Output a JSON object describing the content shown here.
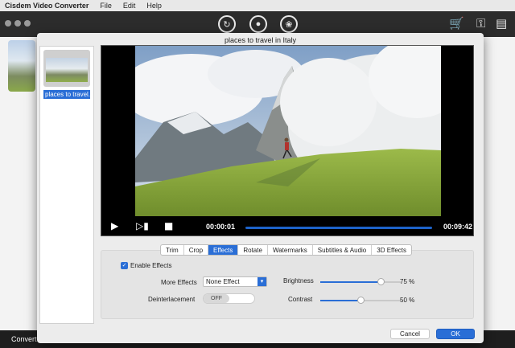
{
  "menubar": {
    "app_name": "Cisdem Video Converter",
    "items": [
      "File",
      "Edit",
      "Help"
    ]
  },
  "toolbar": {
    "icons": [
      "convert-icon",
      "dvd-icon",
      "film-reel-icon"
    ],
    "right_icons": [
      "cart-icon",
      "key-icon",
      "register-icon"
    ]
  },
  "bottom": {
    "convert_label": "Convert a"
  },
  "dialog": {
    "title": "places to travel in Italy",
    "list": {
      "item_label": "places to travel..."
    },
    "player": {
      "current_time": "00:00:01",
      "total_time": "00:09:42",
      "progress": 0.003
    },
    "tabs": [
      "Trim",
      "Crop",
      "Effects",
      "Rotate",
      "Watermarks",
      "Subtitles & Audio",
      "3D Effects"
    ],
    "active_tab": "Effects",
    "effects": {
      "enable_label": "Enable Effects",
      "enabled": true,
      "more_effects_label": "More Effects",
      "more_effects_value": "None Effect",
      "deinterlace_label": "Deinterlacement",
      "deinterlace_value": "OFF",
      "brightness_label": "Brightness",
      "brightness_value": "75 %",
      "brightness_pct": 75,
      "contrast_label": "Contrast",
      "contrast_value": "50 %",
      "contrast_pct": 50
    },
    "buttons": {
      "cancel": "Cancel",
      "ok": "OK"
    }
  },
  "colors": {
    "accent": "#2a6ed6",
    "toolbar": "#2c2c2c"
  }
}
